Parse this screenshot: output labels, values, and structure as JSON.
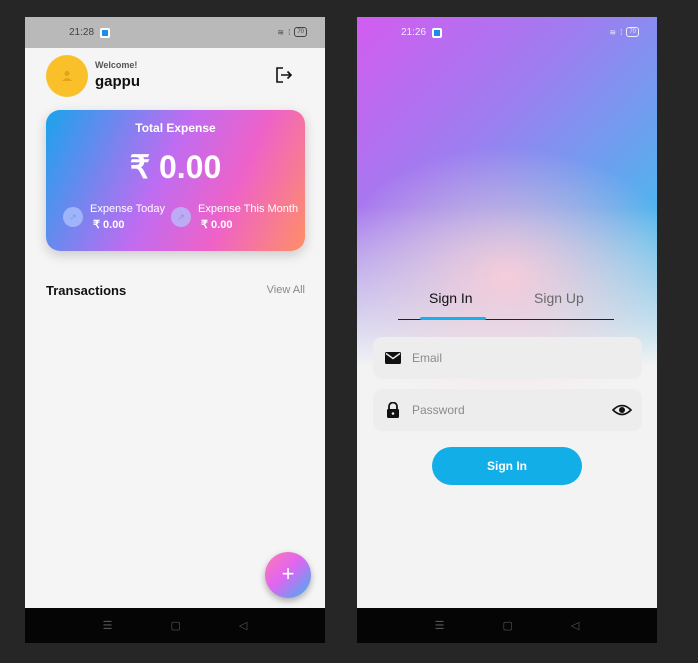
{
  "left_screen": {
    "status_time": "21:28",
    "battery": "70",
    "welcome_text": "Welcome!",
    "username": "gappu",
    "card": {
      "title": "Total Expense",
      "total": "₹ 0.00",
      "today_label": "Expense Today",
      "today_value": "₹ 0.00",
      "month_label": "Expense This Month",
      "month_value": "₹ 0.00"
    },
    "transactions_title": "Transactions",
    "view_all": "View All",
    "fab_symbol": "+"
  },
  "right_screen": {
    "status_time": "21:26",
    "battery": "70",
    "tabs": [
      "Sign In",
      "Sign Up"
    ],
    "active_tab": "Sign In",
    "email_placeholder": "Email",
    "password_placeholder": "Password",
    "signin_button": "Sign In"
  },
  "nav_icons": [
    "menu-icon",
    "home-square-icon",
    "back-triangle-icon"
  ],
  "colors": {
    "accent": "#12aee8",
    "avatar": "#f9c02a",
    "background": "#262626"
  }
}
